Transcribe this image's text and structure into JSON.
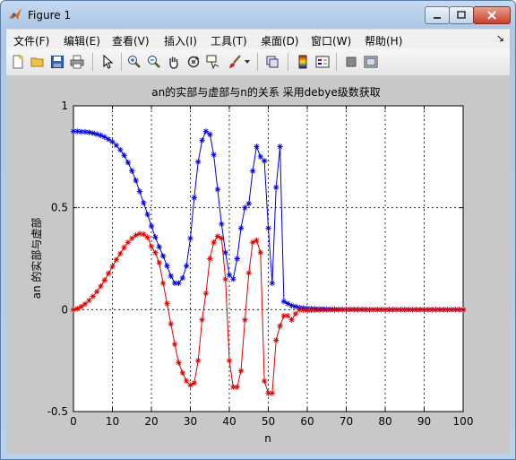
{
  "window": {
    "title": "Figure 1"
  },
  "menu": [
    "文件(F)",
    "编辑(E)",
    "查看(V)",
    "插入(I)",
    "工具(T)",
    "桌面(D)",
    "窗口(W)",
    "帮助(H)"
  ],
  "toolbar": [
    "new-file-icon",
    "open-folder-icon",
    "save-icon",
    "print-icon",
    "pointer-icon",
    "zoom-in-icon",
    "zoom-out-icon",
    "pan-hand-icon",
    "rotate-3d-icon",
    "data-cursor-icon",
    "brush-icon",
    "link-icon",
    "colorbar-icon",
    "legend-icon",
    "hide-plot-tools-icon",
    "show-plot-tools-icon"
  ],
  "colors": {
    "real": "#dd0000",
    "imag": "#0000dd",
    "figure_bg": "#c8c8c8"
  },
  "chart_data": {
    "type": "line",
    "title": "an的实部与虚部与n的关系 采用debye级数获取",
    "xlabel": "n",
    "ylabel": "an 的实部与虚部",
    "xlim": [
      0,
      100
    ],
    "ylim": [
      -0.5,
      1
    ],
    "xticks": [
      0,
      10,
      20,
      30,
      40,
      50,
      60,
      70,
      80,
      90,
      100
    ],
    "yticks": [
      -0.5,
      0,
      0.5,
      1
    ],
    "ytick_labels": [
      "-0.5",
      "0",
      "0.5",
      "1"
    ],
    "grid": true,
    "marker": "*",
    "series": [
      {
        "key": "imag",
        "x": [
          0,
          1,
          2,
          3,
          4,
          5,
          6,
          7,
          8,
          9,
          10,
          11,
          12,
          13,
          14,
          15,
          16,
          17,
          18,
          19,
          20,
          21,
          22,
          23,
          24,
          25,
          26,
          27,
          28,
          29,
          30,
          31,
          32,
          33,
          34,
          35,
          36,
          37,
          38,
          39,
          40,
          41,
          42,
          43,
          44,
          45,
          46,
          47,
          48,
          49,
          50,
          51,
          52,
          53,
          54,
          55,
          56,
          57,
          58,
          59,
          60,
          61,
          62,
          63,
          64,
          65,
          66,
          67,
          68,
          69,
          70,
          71,
          72,
          73,
          74,
          75,
          76,
          77,
          78,
          79,
          80,
          81,
          82,
          83,
          84,
          85,
          86,
          87,
          88,
          89,
          90,
          91,
          92,
          93,
          94,
          95,
          96,
          97,
          98,
          99,
          100
        ],
        "y": [
          0.875,
          0.875,
          0.873,
          0.872,
          0.87,
          0.866,
          0.861,
          0.855,
          0.847,
          0.836,
          0.823,
          0.806,
          0.784,
          0.757,
          0.722,
          0.681,
          0.634,
          0.58,
          0.524,
          0.467,
          0.41,
          0.356,
          0.308,
          0.263,
          0.215,
          0.165,
          0.13,
          0.13,
          0.155,
          0.215,
          0.35,
          0.55,
          0.725,
          0.83,
          0.875,
          0.86,
          0.76,
          0.59,
          0.42,
          0.28,
          0.17,
          0.15,
          0.25,
          0.4,
          0.5,
          0.52,
          0.68,
          0.8,
          0.75,
          0.73,
          0.4,
          0.13,
          0.6,
          0.8,
          0.04,
          0.03,
          0.02,
          0.015,
          0.01,
          0.008,
          0.006,
          0.005,
          0.004,
          0.003,
          0.003,
          0.002,
          0.002,
          0.002,
          0.001,
          0.001,
          0.001,
          0.001,
          0.001,
          0.001,
          0.001,
          0.0,
          0.0,
          0.0,
          0.0,
          0.0,
          0.0,
          0.0,
          0.0,
          0.0,
          0.0,
          0.0,
          0.0,
          0.0,
          0.0,
          0.0,
          0.0,
          0.0,
          0.0,
          0.0,
          0.0,
          0.0,
          0.0,
          0.0,
          0.0,
          0.0,
          0.0
        ]
      },
      {
        "key": "real",
        "x": [
          0,
          1,
          2,
          3,
          4,
          5,
          6,
          7,
          8,
          9,
          10,
          11,
          12,
          13,
          14,
          15,
          16,
          17,
          18,
          19,
          20,
          21,
          22,
          23,
          24,
          25,
          26,
          27,
          28,
          29,
          30,
          31,
          32,
          33,
          34,
          35,
          36,
          37,
          38,
          39,
          40,
          41,
          42,
          43,
          44,
          45,
          46,
          47,
          48,
          49,
          50,
          51,
          52,
          53,
          54,
          55,
          56,
          57,
          58,
          59,
          60,
          61,
          62,
          63,
          64,
          65,
          66,
          67,
          68,
          69,
          70,
          71,
          72,
          73,
          74,
          75,
          76,
          77,
          78,
          79,
          80,
          81,
          82,
          83,
          84,
          85,
          86,
          87,
          88,
          89,
          90,
          91,
          92,
          93,
          94,
          95,
          96,
          97,
          98,
          99,
          100
        ],
        "y": [
          0.0,
          0.005,
          0.015,
          0.028,
          0.045,
          0.065,
          0.088,
          0.115,
          0.145,
          0.178,
          0.212,
          0.245,
          0.275,
          0.305,
          0.33,
          0.35,
          0.365,
          0.372,
          0.37,
          0.355,
          0.31,
          0.28,
          0.23,
          0.13,
          0.03,
          -0.07,
          -0.17,
          -0.26,
          -0.31,
          -0.35,
          -0.37,
          -0.36,
          -0.25,
          -0.05,
          0.08,
          0.25,
          0.33,
          0.36,
          0.35,
          0.15,
          -0.25,
          -0.38,
          -0.38,
          -0.3,
          -0.05,
          0.18,
          0.33,
          0.34,
          0.28,
          -0.35,
          -0.41,
          -0.41,
          -0.15,
          -0.08,
          -0.03,
          -0.03,
          -0.05,
          -0.02,
          0.0,
          -0.002,
          -0.004,
          -0.003,
          -0.002,
          -0.002,
          -0.001,
          -0.001,
          -0.001,
          -0.001,
          -0.001,
          0.0,
          0.0,
          0.0,
          0.0,
          0.0,
          0.0,
          0.0,
          0.0,
          0.0,
          0.0,
          0.0,
          0.0,
          0.0,
          0.0,
          0.0,
          0.0,
          0.0,
          0.0,
          0.0,
          0.0,
          0.0,
          0.0,
          0.0,
          0.0,
          0.0,
          0.0,
          0.0,
          0.0,
          0.0,
          0.0,
          0.0,
          0.0
        ]
      }
    ]
  }
}
